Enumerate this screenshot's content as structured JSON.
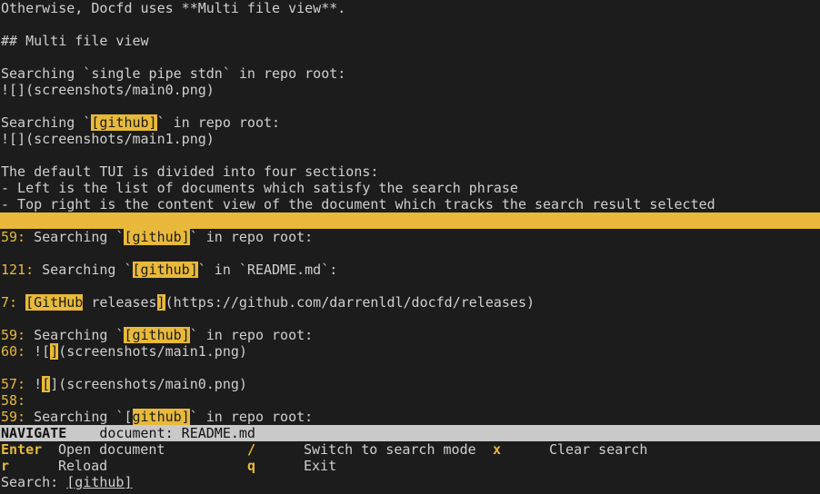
{
  "preview": {
    "line1": "Otherwise, Docfd uses **Multi file view**.",
    "line2": "",
    "line3": "## Multi file view",
    "line4": "",
    "line5": "Searching `single pipe stdn` in repo root:",
    "line6": "![](screenshots/main0.png)",
    "line7": "",
    "line8_pre": "Searching `",
    "line8_hl": "[github]",
    "line8_post": "` in repo root:",
    "line9": "![](screenshots/main1.png)",
    "line10": "",
    "line11": "The default TUI is divided into four sections:",
    "line12": "- Left is the list of documents which satisfy the search phrase",
    "line13": "- Top right is the content view of the document which tracks the search result selected"
  },
  "results": [
    {
      "ln": "59:",
      "pre": " Searching `",
      "hl": "[github]",
      "post": "` in repo root:"
    },
    {
      "ln": "121:",
      "pre": " Searching `",
      "hl": "[github]",
      "post": "` in `README.md`:"
    },
    {
      "ln": "7:",
      "pre": " ",
      "hl": "[GitHub",
      "mid": " releases",
      "hl2": "]",
      "post": "(https://github.com/darrenldl/docfd/releases)"
    },
    {
      "ln": "59:",
      "pre": " Searching `",
      "hl": "[github]",
      "post": "` in repo root:"
    },
    {
      "ln": "60:",
      "pre": " ![",
      "hl": "]",
      "post": "(screenshots/main1.png)"
    },
    {
      "ln": "57:",
      "pre": " !",
      "hl": "[",
      "post": "](screenshots/main0.png)"
    },
    {
      "ln": "58:"
    },
    {
      "ln": "59:",
      "pre": " Searching `",
      "hl_pre": "[",
      "hl": "github]",
      "post": "` in repo root:"
    }
  ],
  "status": {
    "mode": "NAVIGATE",
    "document": "    document: README.md"
  },
  "help": {
    "enter_key": "Enter",
    "enter_label": "Open document",
    "slash_key": "/",
    "slash_label": "Switch to search mode",
    "x_key": "x",
    "x_label": "Clear search",
    "r_key": "r",
    "r_label": "Reload",
    "q_key": "q",
    "q_label": "Exit"
  },
  "search": {
    "label": "Search: ",
    "value": "[github]"
  }
}
